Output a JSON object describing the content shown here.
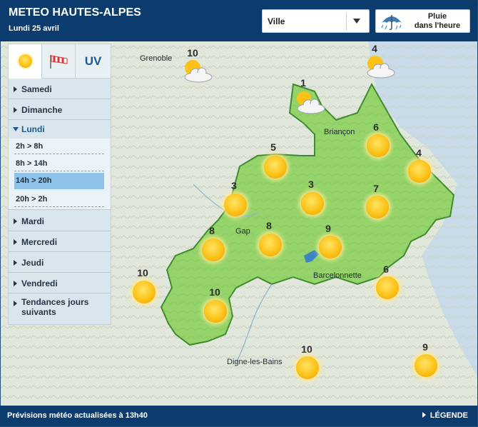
{
  "header": {
    "title": "METEO HAUTES-ALPES",
    "date": "Lundi 25 avril",
    "ville_label": "Ville",
    "pluie_label_line1": "Pluie",
    "pluie_label_line2": "dans l'heure"
  },
  "tabs": [
    {
      "name": "sun-icon"
    },
    {
      "name": "wind-icon"
    },
    {
      "label": "UV"
    }
  ],
  "days": [
    {
      "label": "Samedi"
    },
    {
      "label": "Dimanche"
    },
    {
      "label": "Lundi"
    },
    {
      "label": "Mardi"
    },
    {
      "label": "Mercredi"
    },
    {
      "label": "Jeudi"
    },
    {
      "label": "Vendredi"
    },
    {
      "label": "Tendances jours suivants"
    }
  ],
  "slots": [
    {
      "label": "2h > 8h"
    },
    {
      "label": "8h > 14h"
    },
    {
      "label": "14h > 20h"
    },
    {
      "label": "20h > 2h"
    }
  ],
  "map": {
    "cities": [
      "Grenoble",
      "Briançon",
      "Gap",
      "Barcelonnette",
      "Digne-les-Bains"
    ],
    "temps": [
      "10",
      "4",
      "1",
      "6",
      "5",
      "4",
      "3",
      "3",
      "7",
      "8",
      "8",
      "9",
      "10",
      "6",
      "10",
      "10",
      "9"
    ]
  },
  "footer": {
    "text": "Prévisions météo actualisées à 13h40",
    "legend": "LÉGENDE"
  },
  "colors": {
    "header_bg": "#0c3c6e",
    "region_green": "#94d46a",
    "active_slot": "#8ec2e8"
  }
}
